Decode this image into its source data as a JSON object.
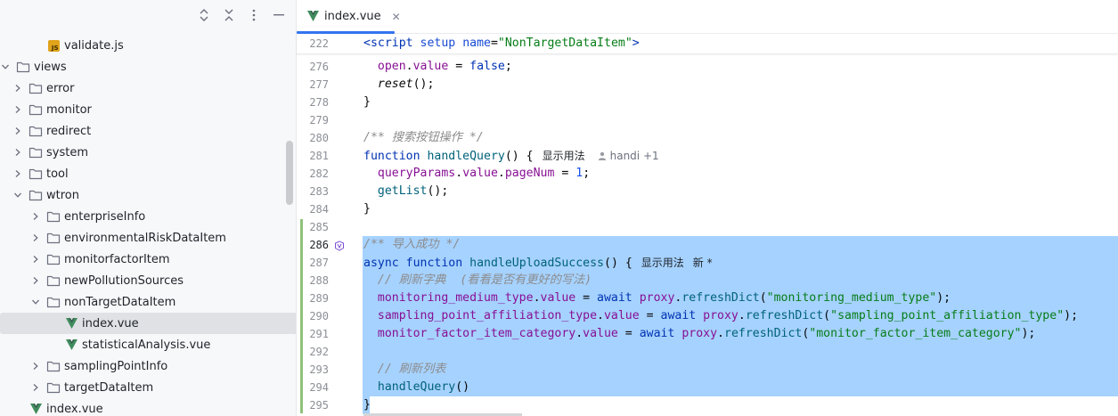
{
  "tree": {
    "items": [
      {
        "label": "validate.js",
        "type": "js",
        "level": 2,
        "expanded": null
      },
      {
        "label": "views",
        "type": "folder",
        "level": 0,
        "expanded": true
      },
      {
        "label": "error",
        "type": "folder",
        "level": 1,
        "expanded": false
      },
      {
        "label": "monitor",
        "type": "folder",
        "level": 1,
        "expanded": false
      },
      {
        "label": "redirect",
        "type": "folder",
        "level": 1,
        "expanded": false
      },
      {
        "label": "system",
        "type": "folder",
        "level": 1,
        "expanded": false
      },
      {
        "label": "tool",
        "type": "folder",
        "level": 1,
        "expanded": false
      },
      {
        "label": "wtron",
        "type": "folder",
        "level": 1,
        "expanded": true
      },
      {
        "label": "enterpriseInfo",
        "type": "folder",
        "level": 2,
        "expanded": false
      },
      {
        "label": "environmentalRiskDataItem",
        "type": "folder",
        "level": 2,
        "expanded": false
      },
      {
        "label": "monitorfactorItem",
        "type": "folder",
        "level": 2,
        "expanded": false
      },
      {
        "label": "newPollutionSources",
        "type": "folder",
        "level": 2,
        "expanded": false
      },
      {
        "label": "nonTargetDataItem",
        "type": "folder",
        "level": 2,
        "expanded": true
      },
      {
        "label": "index.vue",
        "type": "vue",
        "level": 3,
        "expanded": null,
        "selected": true
      },
      {
        "label": "statisticalAnalysis.vue",
        "type": "vue",
        "level": 3,
        "expanded": null
      },
      {
        "label": "samplingPointInfo",
        "type": "folder",
        "level": 2,
        "expanded": false
      },
      {
        "label": "targetDataItem",
        "type": "folder",
        "level": 2,
        "expanded": false
      },
      {
        "label": "index.vue",
        "type": "vue",
        "level": 1,
        "expanded": null
      }
    ]
  },
  "editor": {
    "tab": {
      "label": "index.vue",
      "close": "✕"
    },
    "sticky": {
      "line": "222"
    },
    "lines": [
      {
        "n": "276",
        "parts": [
          [
            "pl",
            "  "
          ],
          [
            "prop",
            "open"
          ],
          [
            "pl",
            "."
          ],
          [
            "prop",
            "value"
          ],
          [
            "pl",
            " = "
          ],
          [
            "kw",
            "false"
          ],
          [
            "pl",
            ";"
          ]
        ]
      },
      {
        "n": "277",
        "parts": [
          [
            "pl",
            "  "
          ],
          [
            "it",
            "reset"
          ],
          [
            "pl",
            "();"
          ]
        ]
      },
      {
        "n": "278",
        "parts": [
          [
            "pl",
            "}"
          ]
        ]
      },
      {
        "n": "279",
        "parts": []
      },
      {
        "n": "280",
        "parts": [
          [
            "cm",
            "/** 搜索按钮操作 */"
          ]
        ]
      },
      {
        "n": "281",
        "parts": [
          [
            "kw",
            "function"
          ],
          [
            "pl",
            " "
          ],
          [
            "fn",
            "handleQuery"
          ],
          [
            "pl",
            "() {"
          ]
        ],
        "hint": "显示用法",
        "author": "handi +1"
      },
      {
        "n": "282",
        "parts": [
          [
            "pl",
            "  "
          ],
          [
            "prop",
            "queryParams"
          ],
          [
            "pl",
            "."
          ],
          [
            "prop",
            "value"
          ],
          [
            "pl",
            "."
          ],
          [
            "prop",
            "pageNum"
          ],
          [
            "pl",
            " = "
          ],
          [
            "num",
            "1"
          ],
          [
            "pl",
            ";"
          ]
        ]
      },
      {
        "n": "283",
        "parts": [
          [
            "pl",
            "  "
          ],
          [
            "fn",
            "getList"
          ],
          [
            "pl",
            "();"
          ]
        ]
      },
      {
        "n": "284",
        "parts": [
          [
            "pl",
            "}"
          ]
        ]
      },
      {
        "n": "285",
        "parts": []
      },
      {
        "n": "286",
        "parts": [
          [
            "cm",
            "/** 导入成功 */"
          ]
        ],
        "selected": true,
        "current": true
      },
      {
        "n": "287",
        "parts": [
          [
            "kw",
            "async"
          ],
          [
            "pl",
            " "
          ],
          [
            "kw",
            "function"
          ],
          [
            "pl",
            " "
          ],
          [
            "fn",
            "handleUploadSuccess"
          ],
          [
            "pl",
            "() {"
          ]
        ],
        "hint": "显示用法",
        "badge": "新 *",
        "selected": true
      },
      {
        "n": "288",
        "parts": [
          [
            "pl",
            "  "
          ],
          [
            "cm",
            "// 刷新字典  (看看是否有更好的写法)"
          ]
        ],
        "selected": true
      },
      {
        "n": "289",
        "parts": [
          [
            "pl",
            "  "
          ],
          [
            "prop",
            "monitoring_medium_type"
          ],
          [
            "pl",
            "."
          ],
          [
            "prop",
            "value"
          ],
          [
            "pl",
            " = "
          ],
          [
            "kw",
            "await"
          ],
          [
            "pl",
            " "
          ],
          [
            "prop",
            "proxy"
          ],
          [
            "pl",
            "."
          ],
          [
            "fn",
            "refreshDict"
          ],
          [
            "pl",
            "("
          ],
          [
            "str",
            "\"monitoring_medium_type\""
          ],
          [
            "pl",
            ");"
          ]
        ],
        "selected": true
      },
      {
        "n": "290",
        "parts": [
          [
            "pl",
            "  "
          ],
          [
            "prop",
            "sampling_point_affiliation_type"
          ],
          [
            "pl",
            "."
          ],
          [
            "prop",
            "value"
          ],
          [
            "pl",
            " = "
          ],
          [
            "kw",
            "await"
          ],
          [
            "pl",
            " "
          ],
          [
            "prop",
            "proxy"
          ],
          [
            "pl",
            "."
          ],
          [
            "fn",
            "refreshDict"
          ],
          [
            "pl",
            "("
          ],
          [
            "str",
            "\"sampling_point_affiliation_type\""
          ],
          [
            "pl",
            ");"
          ]
        ],
        "selected": true
      },
      {
        "n": "291",
        "parts": [
          [
            "pl",
            "  "
          ],
          [
            "prop",
            "monitor_factor_item_category"
          ],
          [
            "pl",
            "."
          ],
          [
            "prop",
            "value"
          ],
          [
            "pl",
            " = "
          ],
          [
            "kw",
            "await"
          ],
          [
            "pl",
            " "
          ],
          [
            "prop",
            "proxy"
          ],
          [
            "pl",
            "."
          ],
          [
            "fn",
            "refreshDict"
          ],
          [
            "pl",
            "("
          ],
          [
            "str",
            "\"monitor_factor_item_category\""
          ],
          [
            "pl",
            ");"
          ]
        ],
        "selected": true
      },
      {
        "n": "292",
        "parts": [],
        "selected": true
      },
      {
        "n": "293",
        "parts": [
          [
            "pl",
            "  "
          ],
          [
            "cm",
            "// 刷新列表"
          ]
        ],
        "selected": true
      },
      {
        "n": "294",
        "parts": [
          [
            "pl",
            "  "
          ],
          [
            "fn",
            "handleQuery"
          ],
          [
            "pl",
            "()"
          ]
        ],
        "selected": true
      },
      {
        "n": "295",
        "parts": [
          [
            "pl",
            "}"
          ]
        ],
        "selected": true,
        "partial": true
      }
    ]
  },
  "colors": {
    "selection": "#a6d2ff",
    "accent": "#3574f0",
    "change_marker": "#8ec27b",
    "vue_green": "#3e8c5c"
  }
}
